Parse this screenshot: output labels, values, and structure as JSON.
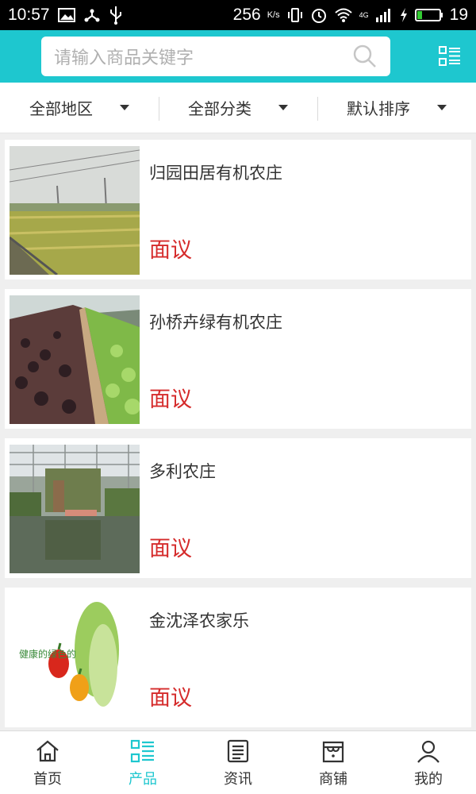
{
  "status_bar": {
    "time": "10:57",
    "net_speed": "256",
    "net_unit": "K/s",
    "net_type": "4G",
    "battery": "19"
  },
  "header": {
    "search_placeholder": "请输入商品关键字"
  },
  "filters": [
    {
      "label": "全部地区"
    },
    {
      "label": "全部分类"
    },
    {
      "label": "默认排序"
    }
  ],
  "products": [
    {
      "name": "归园田居有机农庄",
      "price": "面议"
    },
    {
      "name": "孙桥卉绿有机农庄",
      "price": "面议"
    },
    {
      "name": "多利农庄",
      "price": "面议"
    },
    {
      "name": "金沈泽农家乐",
      "price": "面议"
    }
  ],
  "product4_image_text": "健康的绿色的",
  "tabs": [
    {
      "label": "首页",
      "icon": "home-icon"
    },
    {
      "label": "产品",
      "icon": "product-grid-icon",
      "active": true
    },
    {
      "label": "资讯",
      "icon": "news-icon"
    },
    {
      "label": "商铺",
      "icon": "shop-icon"
    },
    {
      "label": "我的",
      "icon": "user-icon"
    }
  ],
  "colors": {
    "accent": "#1ec7cf",
    "price": "#d52b2b"
  }
}
